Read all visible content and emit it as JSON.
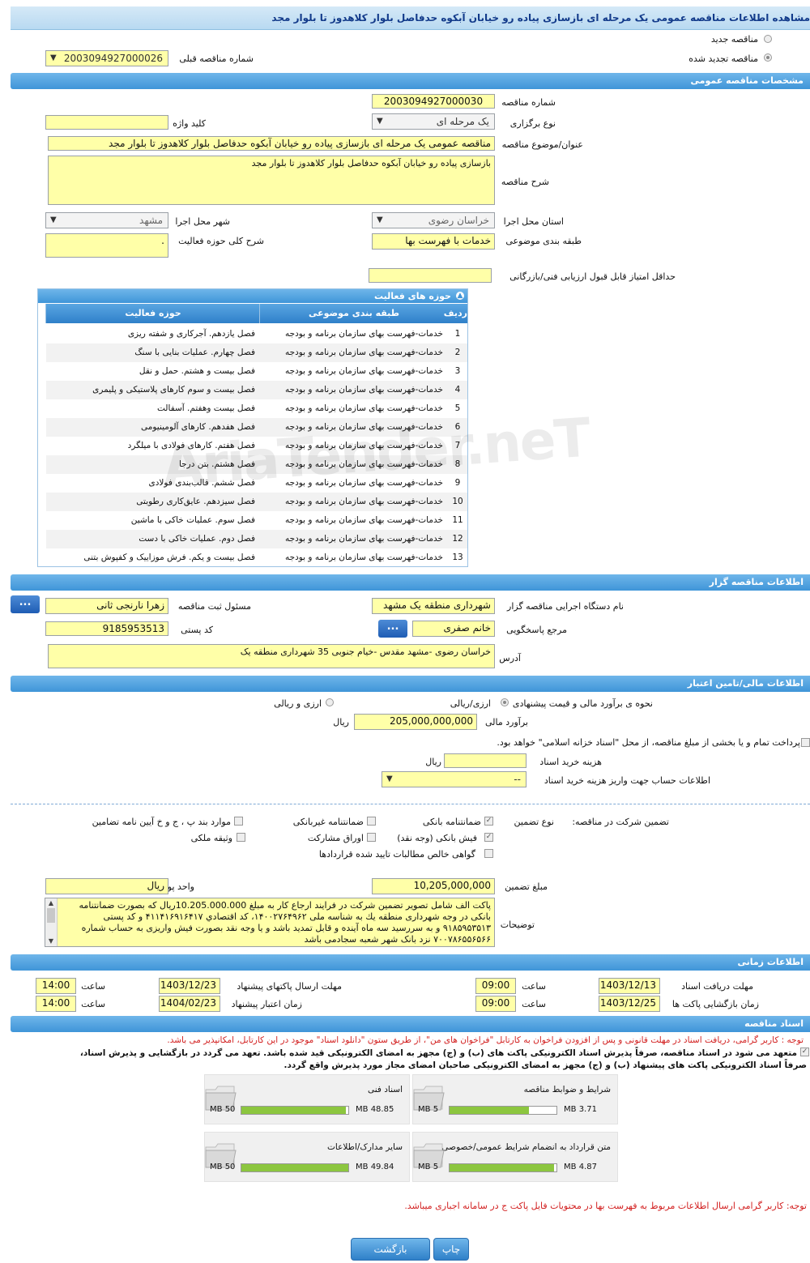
{
  "page_title": "مشاهده اطلاعات مناقصه عمومی یک مرحله ای بازسازی پیاده رو خیابان آبکوه حدفاصل بلوار کلاهدوز تا بلوار مجد",
  "top": {
    "new_tender": "مناقصه جدید",
    "renewed_tender": "مناقصه تجدید شده",
    "prev_number_label": "شماره مناقصه قبلی",
    "prev_number_value": "2003094927000026"
  },
  "general": {
    "header": "مشخصات مناقصه عمومی",
    "number_label": "شماره مناقصه",
    "number_value": "2003094927000030",
    "type_label": "نوع برگزاری",
    "type_value": "یک مرحله ای",
    "keyword_label": "کلید واژه",
    "keyword_value": "",
    "subject_label": "عنوان/موضوع مناقصه",
    "subject_value": "مناقصه عمومی یک مرحله ای بازسازی پیاده رو خیابان آبکوه حدفاصل بلوار کلاهدوز تا بلوار مجد",
    "desc_label": "شرح مناقصه",
    "desc_value": "بازسازی پیاده رو خیابان آبکوه حدفاصل بلوار کلاهدوز تا بلوار مجد",
    "province_label": "استان محل اجرا",
    "province_value": "خراسان رضوی",
    "city_label": "شهر محل اجرا",
    "city_value": "مشهد",
    "category_label": "طبقه بندی موضوعی",
    "category_value": "خدمات با فهرست بها",
    "activity_desc_label": "شرح کلی حوزه فعالیت",
    "activity_desc_value": ".",
    "min_score_label": "حداقل امتیاز قابل قبول ارزیابی فنی/بازرگانی",
    "min_score_value": ""
  },
  "activities": {
    "header": "حوزه های فعالیت",
    "col_row": "ردیف",
    "col_category": "طبقه بندی موضوعی",
    "col_field": "حوزه فعالیت",
    "rows": [
      {
        "n": "1",
        "cat": "خدمات-فهرست بهای سازمان برنامه و بودجه",
        "field": "فصل یازدهم. آجرکاری و شفته ریزی"
      },
      {
        "n": "2",
        "cat": "خدمات-فهرست بهای سازمان برنامه و بودجه",
        "field": "فصل چهارم. عملیات بنایی با سنگ"
      },
      {
        "n": "3",
        "cat": "خدمات-فهرست بهای سازمان برنامه و بودجه",
        "field": "فصل بیست و هشتم. حمل و نقل"
      },
      {
        "n": "4",
        "cat": "خدمات-فهرست بهای سازمان برنامه و بودجه",
        "field": "فصل بیست و سوم کارهای پلاستیکی و پلیمری"
      },
      {
        "n": "5",
        "cat": "خدمات-فهرست بهای سازمان برنامه و بودجه",
        "field": "فصل بیست وهفتم. آسفالت"
      },
      {
        "n": "6",
        "cat": "خدمات-فهرست بهای سازمان برنامه و بودجه",
        "field": "فصل هفدهم. کارهای آلومینیومی"
      },
      {
        "n": "7",
        "cat": "خدمات-فهرست بهای سازمان برنامه و بودجه",
        "field": "فصل هفتم. کارهای فولادی با میلگرد"
      },
      {
        "n": "8",
        "cat": "خدمات-فهرست بهای سازمان برنامه و بودجه",
        "field": "فصل هشتم. بتن درجا"
      },
      {
        "n": "9",
        "cat": "خدمات-فهرست بهای سازمان برنامه و بودجه",
        "field": "فصل ششم. قالب‌بندی فولادی"
      },
      {
        "n": "10",
        "cat": "خدمات-فهرست بهای سازمان برنامه و بودجه",
        "field": "فصل سیزدهم. عایق‌کاری رطوبتی"
      },
      {
        "n": "11",
        "cat": "خدمات-فهرست بهای سازمان برنامه و بودجه",
        "field": "فصل سوم. عملیات خاکی با ماشین"
      },
      {
        "n": "12",
        "cat": "خدمات-فهرست بهای سازمان برنامه و بودجه",
        "field": "فصل دوم. عملیات خاکی با دست"
      },
      {
        "n": "13",
        "cat": "خدمات-فهرست بهای سازمان برنامه و بودجه",
        "field": "فصل بیست و یکم. فرش موزاییک و کفپوش بتنی"
      }
    ]
  },
  "organizer": {
    "header": "اطلاعات مناقصه گزار",
    "org_label": "نام دستگاه اجرایی مناقصه گزار",
    "org_value": "شهرداری منطقه یک مشهد",
    "registrar_label": "مسئول ثبت مناقصه",
    "registrar_value": "زهرا نارنجی ثانی",
    "contact_label": "مرجع پاسخگویی",
    "contact_value": "خانم صفری",
    "postal_label": "کد پستی",
    "postal_value": "9185953513",
    "address_label": "آدرس",
    "address_value": "خراسان رضوی -مشهد مقدس -خیام جنوبی 35 شهرداری منطقه یک",
    "dots": "..."
  },
  "finance": {
    "header": "اطلاعات مالی/تامین اعتبار",
    "estimate_method_label": "نحوه ی برآورد مالی و قیمت پیشنهادی",
    "opt_rial": "ارزی/ریالی",
    "opt_fx": "ارزی و ریالی",
    "estimate_label": "برآورد مالی",
    "estimate_value": "205,000,000,000",
    "currency": "ریال",
    "treasury_text": "پرداخت تمام و یا بخشی از مبلغ مناقصه، از محل \"اسناد خزانه اسلامی\" خواهد بود.",
    "doc_fee_label": "هزینه خرید اسناد",
    "doc_fee_value": "",
    "account_label": "اطلاعات حساب جهت واریز هزینه خرید اسناد",
    "account_value": "--"
  },
  "guarantee": {
    "participation_label": "تضمین شرکت در مناقصه:",
    "type_label": "نوع تضمین",
    "bank_guarantee": "ضمانتنامه بانکی",
    "non_bank_guarantee": "ضمانتنامه غیربانکی",
    "bylaw_items": "موارد بند پ ، ج و خ آیین نامه تضامین",
    "cash_receipt": "فیش بانکی (وجه نقد)",
    "participation_bonds": "اوراق مشارکت",
    "property": "وثیقه ملکی",
    "receivables_cert": "گواهی خالص مطالبات تایید شده قراردادها",
    "amount_label": "مبلغ تضمین",
    "amount_value": "10,205,000,000",
    "unit_label": "واحد پول",
    "unit_value": "ریال",
    "notes_label": "توضیحات",
    "notes_value": "پاکت   الف شامل تصویر تضمین شرکت در فرایند ارجاع کار به مبلغ 10.205.000.000ریال که بصورت ضمانتنامه بانکی در وجه شهرداری منطقه یك به شناسه ملی ۱۴۰۰۲۷۶۴۹۶۲، كد اقتصادي ۴۱۱۴۱۶۹۱۶۴۱۷ و كد پستی ۹۱۸۵۹۵۳۵۱۳ و به سررسید سه ماه آینده و قابل تمدید باشد و یا وجه نقد بصورت فیش واریزی به حساب شماره ۷۰۰۷۸۶۵۵۶۵۶۶ نزد بانک شهر شعبه سجادمی باشد"
  },
  "timing": {
    "header": "اطلاعات زمانی",
    "receive_deadline_label": "مهلت دریافت اسناد",
    "receive_deadline_value": "1403/12/13",
    "send_deadline_label": "مهلت ارسال پاکتهای پیشنهاد",
    "send_deadline_value": "1403/12/23",
    "opening_label": "زمان بازگشایی پاکت ها",
    "opening_value": "1403/12/25",
    "validity_label": "زمان اعتبار پیشنهاد",
    "validity_value": "1404/02/23",
    "time_label": "ساعت",
    "time1": "14:00",
    "time2": "14:00",
    "time3": "09:00",
    "time4": "14:00"
  },
  "documents": {
    "header": "اسناد مناقصه",
    "note1": "توجه : کاربر گرامی، دریافت اسناد در مهلت قانونی و پس از افزودن فراخوان به کارتابل \"فراخوان های من\"، از طریق ستون \"دانلود اسناد\" موجود در این کارتابل، امکانپذیر می باشد.",
    "commit1": "متعهد می شود در اسناد مناقصه، صرفاً پذیرش اسناد الکترونیکی پاکت های (ب) و (ج) مجهز به امضای الکترونیکی قید شده باشد. تعهد می گردد در بازگشایی و پذیرش اسناد،",
    "commit2": "صرفاً اسناد الکترونیکی پاکت های پیشنهاد (ب) و (ج) مجهز به امضای الکترونیکی صاحبان امضای مجاز مورد پذیرش واقع گردد.",
    "files": [
      {
        "name": "شرایط و ضوابط مناقصه",
        "used": "3.71 MB",
        "max": "5 MB",
        "ratio": 0.742
      },
      {
        "name": "اسناد فنی",
        "used": "48.85 MB",
        "max": "50 MB",
        "ratio": 0.977
      },
      {
        "name": "متن قرارداد به انضمام شرایط عمومی/خصوصی",
        "used": "4.87 MB",
        "max": "5 MB",
        "ratio": 0.974
      },
      {
        "name": "سایر مدارک/اطلاعات",
        "used": "49.84 MB",
        "max": "50 MB",
        "ratio": 0.997
      }
    ],
    "note2": "توجه: کاربر گرامی ارسال اطلاعات مربوط به فهرست بها در محتویات فایل پاکت ج در سامانه اجباری میباشد."
  },
  "actions": {
    "back": "بازگشت",
    "print": "چاپ"
  },
  "watermark": "AriaTender.neT"
}
